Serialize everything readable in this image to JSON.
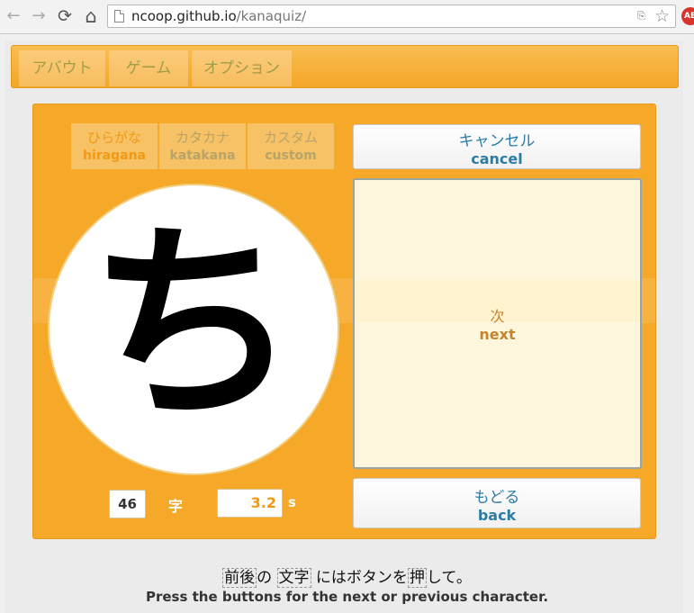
{
  "browser": {
    "url_host": "ncoop.github.io",
    "url_path": "/kanaquiz/",
    "back_glyph": "←",
    "forward_glyph": "→",
    "reload_glyph": "⟳",
    "home_glyph": "⌂",
    "star_glyph": "☆",
    "translate_glyph": "⎘",
    "extension_label": "AB"
  },
  "nav": {
    "tabs": [
      "アバウト",
      "ゲーム",
      "オプション"
    ]
  },
  "kana_tabs": [
    {
      "jp": "ひらがな",
      "en": "hiragana"
    },
    {
      "jp": "カタカナ",
      "en": "katakana"
    },
    {
      "jp": "カスタム",
      "en": "custom"
    }
  ],
  "quiz": {
    "character": "ち",
    "count": "46",
    "count_unit": "字",
    "time": "3.2",
    "time_unit": "s"
  },
  "buttons": {
    "cancel_jp": "キャンセル",
    "cancel_en": "cancel",
    "next_jp": "次",
    "next_en": "next",
    "back_jp": "もどる",
    "back_en": "back"
  },
  "footer": {
    "jp_1": "前後",
    "jp_2": "の",
    "jp_3": "文字",
    "jp_4": "にはボタンを",
    "jp_5": "押",
    "jp_6": "して。",
    "en": "Press the buttons for the next or previous character."
  },
  "colors": {
    "accent": "#f6a828",
    "link": "#2b7da6",
    "next_text": "#c4842f"
  }
}
